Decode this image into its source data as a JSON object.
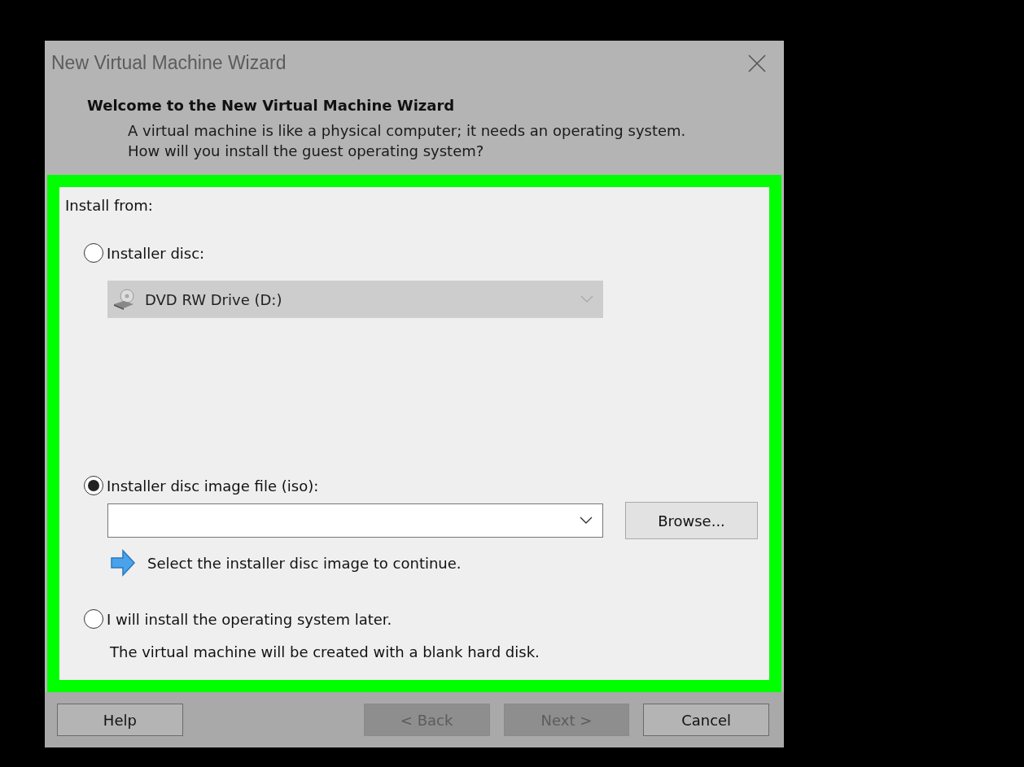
{
  "window": {
    "title": "New Virtual Machine Wizard"
  },
  "header": {
    "title": "Welcome to the New Virtual Machine Wizard",
    "description": "A virtual machine is like a physical computer; it needs an operating system. How will you install the guest operating system?"
  },
  "install_from": {
    "label": "Install from:",
    "options": [
      {
        "kind": "disc",
        "label": "Installer disc:",
        "selected": false,
        "drive": {
          "value": "DVD RW Drive (D:)",
          "disabled": true
        }
      },
      {
        "kind": "iso",
        "label": "Installer disc image file (iso):",
        "selected": true,
        "browse": "Browse...",
        "hint": "Select the installer disc image to continue."
      },
      {
        "kind": "later",
        "label": "I will install the operating system later.",
        "selected": false,
        "note": "The virtual machine will be created with a blank hard disk."
      }
    ]
  },
  "buttons": [
    {
      "label": "Help",
      "disabled": false
    },
    {
      "label": "< Back",
      "disabled": true
    },
    {
      "label": "Next >",
      "disabled": true
    },
    {
      "label": "Cancel",
      "disabled": false
    }
  ]
}
